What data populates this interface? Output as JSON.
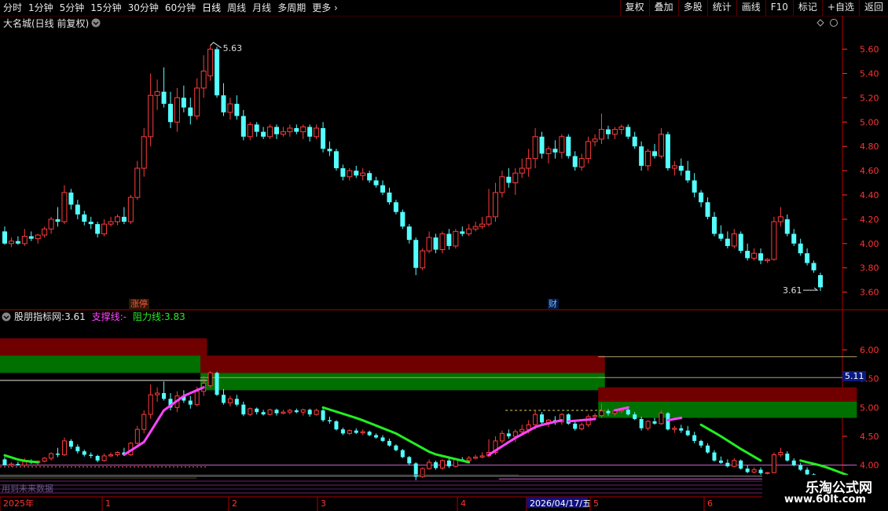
{
  "toolbar": {
    "periods": [
      "分时",
      "1分钟",
      "5分钟",
      "15分钟",
      "30分钟",
      "60分钟",
      "日线",
      "周线",
      "月线",
      "多周期",
      "更多"
    ],
    "active_index": 6,
    "right_buttons": [
      "复权",
      "叠加",
      "多股",
      "统计",
      "画线",
      "F10",
      "标记",
      "+自选",
      "返回"
    ]
  },
  "main_panel": {
    "title": "大名城(日线 前复权)",
    "high_label": "5.63",
    "low_label": "3.61",
    "markers": [
      "涨停",
      "财"
    ]
  },
  "indicator_panel": {
    "name": "股朋指标网",
    "value": "3.61",
    "support_label": "支撑线:",
    "support_value": "-",
    "resistance_label": "阻力线:",
    "resistance_value": "3.83",
    "price_tag": "5.11",
    "bottom_text": "用到未来数据"
  },
  "time_axis": {
    "labels": [
      "2025年",
      "1",
      "2",
      "3",
      "4",
      "2026/04/17/五",
      "5",
      "6"
    ]
  },
  "watermark": {
    "line1": "乐淘公式网",
    "line2": "www.60lt.com"
  },
  "colors": {
    "up": "#ff3c3c",
    "down": "#54ffff",
    "support": "#ff44ff",
    "resistance": "#22ee22",
    "axis": "#ff3333",
    "zone_red": "#700000",
    "zone_green": "#007000"
  },
  "chart_data": {
    "type": "candlestick",
    "title": "大名城(日线 前复权)",
    "y_axis_ticks": [
      3.6,
      3.8,
      4.0,
      4.2,
      4.4,
      4.6,
      4.8,
      5.0,
      5.2,
      5.4,
      5.6
    ],
    "ylim": [
      3.52,
      5.72
    ],
    "indicator_ticks": [
      3.5,
      4.0,
      4.5,
      5.0,
      5.5,
      6.0
    ],
    "indicator_ylim": [
      3.45,
      6.45
    ],
    "x_labels": [
      "2025年",
      "1",
      "2",
      "3",
      "4",
      "2026/04/17/五",
      "5",
      "6"
    ],
    "annotations": {
      "high": 5.63,
      "low": 3.61
    },
    "indicator_zones": [
      {
        "x": [
          0,
          30
        ],
        "red": [
          5.9,
          6.2
        ],
        "green": [
          5.6,
          5.9
        ]
      },
      {
        "x": [
          30,
          90
        ],
        "red": [
          5.6,
          5.9
        ],
        "green": [
          5.3,
          5.6
        ]
      },
      {
        "x": [
          90,
          128
        ],
        "red": [
          5.1,
          5.35
        ],
        "green": [
          4.82,
          5.1
        ]
      }
    ],
    "candles": [
      [
        4.1,
        4.14,
        3.99,
        4.0
      ],
      [
        4.0,
        4.05,
        3.97,
        4.02
      ],
      [
        4.02,
        4.06,
        3.99,
        4.0
      ],
      [
        4.0,
        4.12,
        3.98,
        4.06
      ],
      [
        4.06,
        4.1,
        4.02,
        4.04
      ],
      [
        4.04,
        4.08,
        4.0,
        4.07
      ],
      [
        4.07,
        4.14,
        4.05,
        4.12
      ],
      [
        4.12,
        4.22,
        4.08,
        4.2
      ],
      [
        4.2,
        4.3,
        4.14,
        4.18
      ],
      [
        4.18,
        4.48,
        4.16,
        4.42
      ],
      [
        4.42,
        4.45,
        4.28,
        4.32
      ],
      [
        4.32,
        4.36,
        4.2,
        4.24
      ],
      [
        4.24,
        4.27,
        4.15,
        4.18
      ],
      [
        4.18,
        4.22,
        4.12,
        4.16
      ],
      [
        4.16,
        4.18,
        4.05,
        4.08
      ],
      [
        4.08,
        4.2,
        4.06,
        4.16
      ],
      [
        4.16,
        4.22,
        4.14,
        4.18
      ],
      [
        4.18,
        4.24,
        4.15,
        4.22
      ],
      [
        4.22,
        4.3,
        4.16,
        4.18
      ],
      [
        4.18,
        4.4,
        4.16,
        4.38
      ],
      [
        4.38,
        4.68,
        4.36,
        4.62
      ],
      [
        4.62,
        4.95,
        4.55,
        4.88
      ],
      [
        4.88,
        5.4,
        4.8,
        5.22
      ],
      [
        5.22,
        5.35,
        5.1,
        5.25
      ],
      [
        5.25,
        5.45,
        5.12,
        5.15
      ],
      [
        5.15,
        5.25,
        4.95,
        5.0
      ],
      [
        5.0,
        5.28,
        4.92,
        5.2
      ],
      [
        5.2,
        5.3,
        5.08,
        5.12
      ],
      [
        5.12,
        5.2,
        4.98,
        5.05
      ],
      [
        5.05,
        5.36,
        5.02,
        5.28
      ],
      [
        5.28,
        5.55,
        5.2,
        5.42
      ],
      [
        5.38,
        5.63,
        5.34,
        5.6
      ],
      [
        5.6,
        5.62,
        5.2,
        5.22
      ],
      [
        5.22,
        5.32,
        5.05,
        5.08
      ],
      [
        5.08,
        5.2,
        5.02,
        5.15
      ],
      [
        5.15,
        5.22,
        5.02,
        5.05
      ],
      [
        5.05,
        5.1,
        4.85,
        4.88
      ],
      [
        4.88,
        5.0,
        4.85,
        4.98
      ],
      [
        4.98,
        5.0,
        4.88,
        4.92
      ],
      [
        4.92,
        4.96,
        4.86,
        4.88
      ],
      [
        4.88,
        4.98,
        4.86,
        4.96
      ],
      [
        4.96,
        4.98,
        4.86,
        4.9
      ],
      [
        4.9,
        4.96,
        4.88,
        4.92
      ],
      [
        4.92,
        4.98,
        4.88,
        4.95
      ],
      [
        4.95,
        4.98,
        4.9,
        4.92
      ],
      [
        4.92,
        4.98,
        4.86,
        4.96
      ],
      [
        4.96,
        4.98,
        4.84,
        4.88
      ],
      [
        4.88,
        4.98,
        4.86,
        4.95
      ],
      [
        4.95,
        5.0,
        4.75,
        4.78
      ],
      [
        4.78,
        4.84,
        4.72,
        4.76
      ],
      [
        4.76,
        4.78,
        4.6,
        4.62
      ],
      [
        4.62,
        4.65,
        4.52,
        4.55
      ],
      [
        4.55,
        4.62,
        4.52,
        4.6
      ],
      [
        4.6,
        4.64,
        4.54,
        4.56
      ],
      [
        4.56,
        4.62,
        4.52,
        4.58
      ],
      [
        4.58,
        4.6,
        4.5,
        4.52
      ],
      [
        4.52,
        4.55,
        4.46,
        4.48
      ],
      [
        4.48,
        4.52,
        4.4,
        4.42
      ],
      [
        4.42,
        4.46,
        4.32,
        4.34
      ],
      [
        4.34,
        4.36,
        4.24,
        4.26
      ],
      [
        4.26,
        4.28,
        4.12,
        4.14
      ],
      [
        4.14,
        4.16,
        4.0,
        4.03
      ],
      [
        4.03,
        4.05,
        3.74,
        3.8
      ],
      [
        3.8,
        3.96,
        3.78,
        3.94
      ],
      [
        3.94,
        4.1,
        3.92,
        4.05
      ],
      [
        4.05,
        4.08,
        3.92,
        3.95
      ],
      [
        3.95,
        4.1,
        3.92,
        4.08
      ],
      [
        4.08,
        4.12,
        3.95,
        3.98
      ],
      [
        3.98,
        4.12,
        3.96,
        4.1
      ],
      [
        4.1,
        4.14,
        4.06,
        4.08
      ],
      [
        4.08,
        4.16,
        4.06,
        4.12
      ],
      [
        4.12,
        4.18,
        4.1,
        4.14
      ],
      [
        4.14,
        4.22,
        4.12,
        4.16
      ],
      [
        4.16,
        4.45,
        4.14,
        4.22
      ],
      [
        4.22,
        4.5,
        4.18,
        4.42
      ],
      [
        4.42,
        4.6,
        4.38,
        4.55
      ],
      [
        4.55,
        4.62,
        4.46,
        4.5
      ],
      [
        4.5,
        4.62,
        4.4,
        4.58
      ],
      [
        4.58,
        4.7,
        4.54,
        4.62
      ],
      [
        4.62,
        4.78,
        4.55,
        4.7
      ],
      [
        4.7,
        4.95,
        4.62,
        4.88
      ],
      [
        4.88,
        4.92,
        4.7,
        4.74
      ],
      [
        4.74,
        4.8,
        4.66,
        4.78
      ],
      [
        4.78,
        4.85,
        4.7,
        4.75
      ],
      [
        4.75,
        4.9,
        4.7,
        4.88
      ],
      [
        4.88,
        4.9,
        4.7,
        4.72
      ],
      [
        4.72,
        4.76,
        4.6,
        4.63
      ],
      [
        4.63,
        4.74,
        4.6,
        4.7
      ],
      [
        4.7,
        4.88,
        4.66,
        4.84
      ],
      [
        4.84,
        4.9,
        4.8,
        4.86
      ],
      [
        4.86,
        5.07,
        4.82,
        4.94
      ],
      [
        4.94,
        4.97,
        4.86,
        4.9
      ],
      [
        4.9,
        4.96,
        4.86,
        4.94
      ],
      [
        4.94,
        4.98,
        4.9,
        4.96
      ],
      [
        4.96,
        4.98,
        4.86,
        4.88
      ],
      [
        4.88,
        4.92,
        4.78,
        4.8
      ],
      [
        4.8,
        4.84,
        4.6,
        4.64
      ],
      [
        4.64,
        4.78,
        4.6,
        4.76
      ],
      [
        4.76,
        4.82,
        4.7,
        4.72
      ],
      [
        4.72,
        4.95,
        4.7,
        4.9
      ],
      [
        4.9,
        4.92,
        4.6,
        4.62
      ],
      [
        4.62,
        4.68,
        4.56,
        4.64
      ],
      [
        4.64,
        4.7,
        4.56,
        4.6
      ],
      [
        4.6,
        4.68,
        4.5,
        4.52
      ],
      [
        4.52,
        4.58,
        4.38,
        4.42
      ],
      [
        4.42,
        4.44,
        4.3,
        4.34
      ],
      [
        4.34,
        4.38,
        4.2,
        4.22
      ],
      [
        4.22,
        4.26,
        4.06,
        4.08
      ],
      [
        4.08,
        4.15,
        4.02,
        4.04
      ],
      [
        4.04,
        4.1,
        3.96,
        3.98
      ],
      [
        3.98,
        4.12,
        3.96,
        4.08
      ],
      [
        4.08,
        4.1,
        3.92,
        3.94
      ],
      [
        3.94,
        4.0,
        3.86,
        3.88
      ],
      [
        3.88,
        3.96,
        3.86,
        3.92
      ],
      [
        3.92,
        3.96,
        3.83,
        3.86
      ],
      [
        3.86,
        3.88,
        3.84,
        3.87
      ],
      [
        3.87,
        4.22,
        3.86,
        4.18
      ],
      [
        4.18,
        4.3,
        4.14,
        4.22
      ],
      [
        4.2,
        4.24,
        4.06,
        4.08
      ],
      [
        4.08,
        4.12,
        3.98,
        4.0
      ],
      [
        4.0,
        4.04,
        3.9,
        3.92
      ],
      [
        3.92,
        3.96,
        3.82,
        3.84
      ],
      [
        3.84,
        3.86,
        3.76,
        3.78
      ],
      [
        3.74,
        3.76,
        3.61,
        3.64
      ]
    ]
  }
}
